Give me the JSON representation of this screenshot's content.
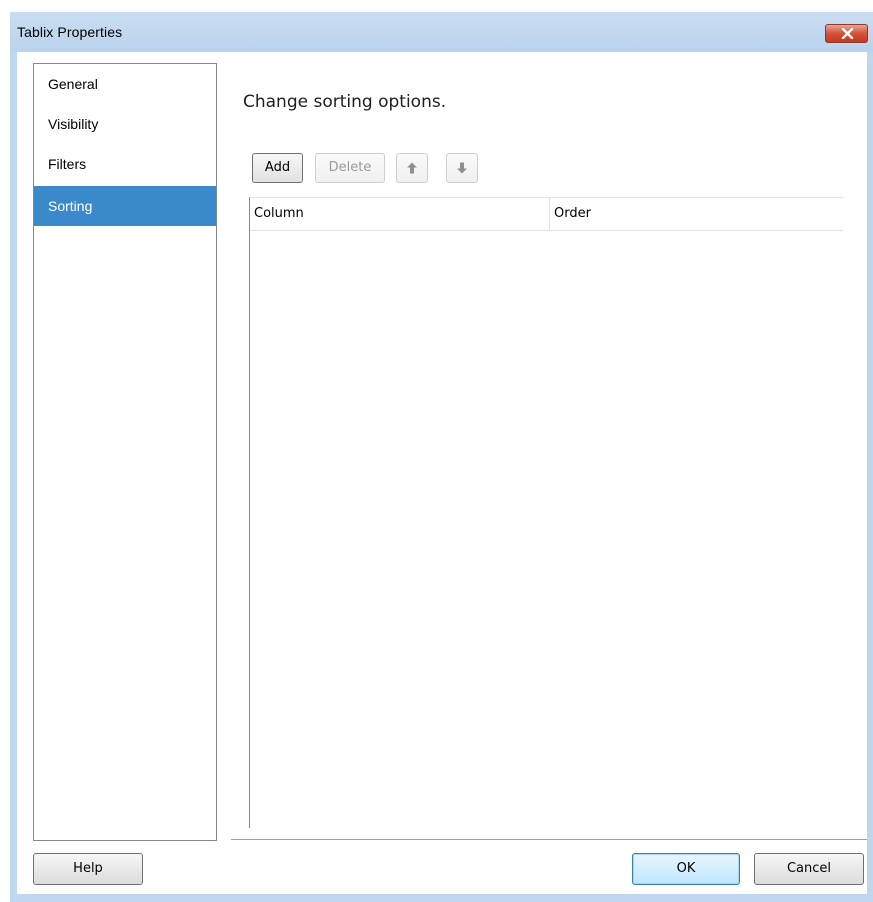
{
  "window": {
    "title": "Tablix Properties",
    "close_icon": "close-icon"
  },
  "nav": {
    "items": [
      {
        "label": "General",
        "selected": false
      },
      {
        "label": "Visibility",
        "selected": false
      },
      {
        "label": "Filters",
        "selected": false
      },
      {
        "label": "Sorting",
        "selected": true
      }
    ]
  },
  "main": {
    "heading": "Change sorting options.",
    "toolbar": {
      "add_label": "Add",
      "delete_label": "Delete",
      "move_up_icon": "arrow-up-icon",
      "move_down_icon": "arrow-down-icon"
    },
    "grid": {
      "columns": [
        "Column",
        "Order"
      ],
      "rows": []
    }
  },
  "footer": {
    "help_label": "Help",
    "ok_label": "OK",
    "cancel_label": "Cancel"
  },
  "colors": {
    "selected_nav": "#3a89cb",
    "title_bar": "#bfd7ee",
    "close_button": "#c43a1f"
  }
}
